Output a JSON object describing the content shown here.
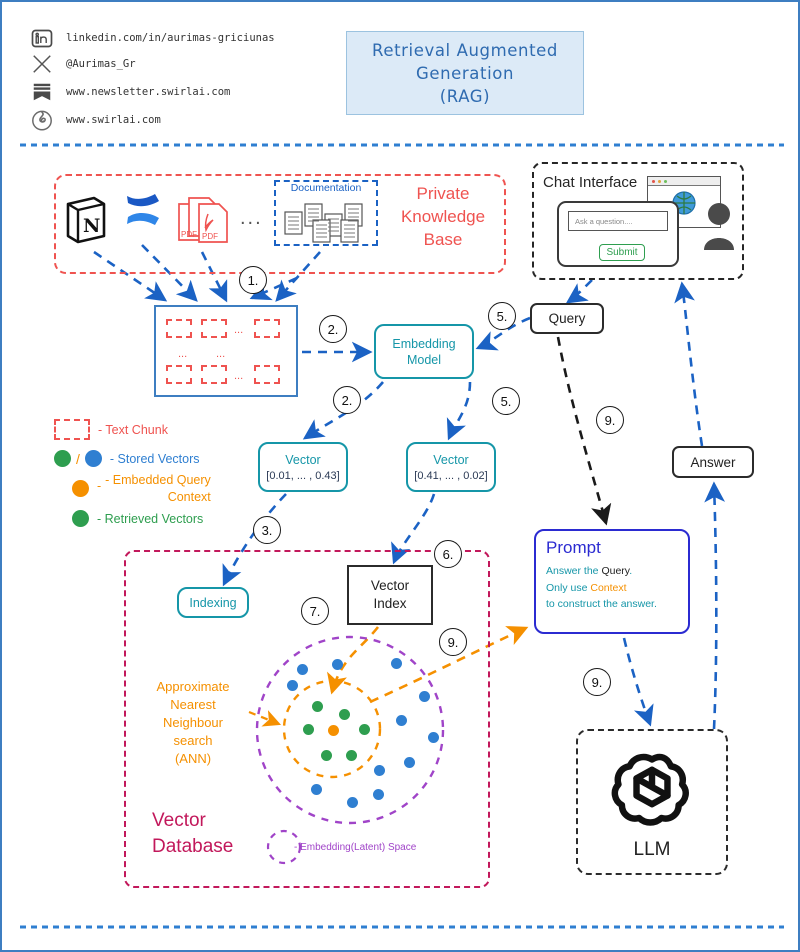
{
  "title": {
    "line1": "Retrieval Augmented",
    "line2": "Generation",
    "line3": "(RAG)"
  },
  "contacts": [
    {
      "icon": "linkedin-icon",
      "text": "linkedin.com/in/aurimas-griciunas"
    },
    {
      "icon": "x-twitter-icon",
      "text": "@Aurimas_Gr"
    },
    {
      "icon": "newsletter-icon",
      "text": "www.newsletter.swirlai.com"
    },
    {
      "icon": "swirl-logo-icon",
      "text": "www.swirlai.com"
    }
  ],
  "knowledge_base": {
    "label": "Private\nKnowledge\nBase",
    "label_lines": [
      "Private",
      "Knowledge",
      "Base"
    ],
    "documentation_label": "Documentation",
    "sources": [
      "notion-icon",
      "excalidraw-icon",
      "pdf-icon",
      "ellipsis",
      "documentation-servers-icon"
    ],
    "ellipsis": "..."
  },
  "chat": {
    "title": "Chat Interface",
    "input_placeholder": "Ask a question....",
    "submit_label": "Submit"
  },
  "chunks": {
    "ellipsis": "...",
    "count_visible": 6
  },
  "embedding_model": {
    "label_line1": "Embedding",
    "label_line2": "Model"
  },
  "vectors": [
    {
      "title": "Vector",
      "value": "[0.01, ... , 0.43]"
    },
    {
      "title": "Vector",
      "value": "[0.41, ... , 0.02]"
    }
  ],
  "query_box": {
    "label": "Query"
  },
  "answer_box": {
    "label": "Answer"
  },
  "indexing": {
    "label": "Indexing"
  },
  "vector_index": {
    "line1": "Vector",
    "line2": "Index"
  },
  "prompt": {
    "title": "Prompt",
    "line1_a": "Answer the ",
    "line1_b": "Query",
    "line1_c": ".",
    "line2_a": "Only use ",
    "line2_b": "Context",
    "line3": "to construct the answer."
  },
  "vector_db": {
    "label_line1": "Vector",
    "label_line2": "Database",
    "ann_lines": [
      "Approximate",
      "Nearest",
      "Neighbour",
      "search",
      "(ANN)"
    ],
    "latent_legend": "- Embedding(Latent) Space"
  },
  "llm": {
    "label": "LLM",
    "icon": "openai-logo-icon"
  },
  "legend": [
    {
      "type": "chunk",
      "text": "- Text Chunk",
      "color": "#ef5350"
    },
    {
      "type": "two-dots",
      "text": "- Stored Vectors",
      "color": "#2f7fd1",
      "color2": "#2e9e4f",
      "separator": "/"
    },
    {
      "type": "dot",
      "text": "- Embedded Query\n Context",
      "text_line1": "- Embedded Query",
      "text_line2": "Context",
      "color": "#f59000"
    },
    {
      "type": "dot",
      "text": "- Retrieved Vectors",
      "color": "#2e9e4f"
    }
  ],
  "steps": [
    "1.",
    "2.",
    "2.",
    "5.",
    "5.",
    "3.",
    "6.",
    "7.",
    "9.",
    "9.",
    "9."
  ],
  "colors": {
    "frame": "#3e7ec1",
    "red": "#ef5350",
    "blue": "#1b62c4",
    "teal": "#1596a8",
    "orange": "#f59000",
    "green": "#2e9e4f",
    "purple": "#a044c8",
    "crimson": "#c2185b",
    "indigo": "#2b2bd1",
    "title_blue": "#2f6bb0",
    "title_bg": "#dceaf7"
  }
}
